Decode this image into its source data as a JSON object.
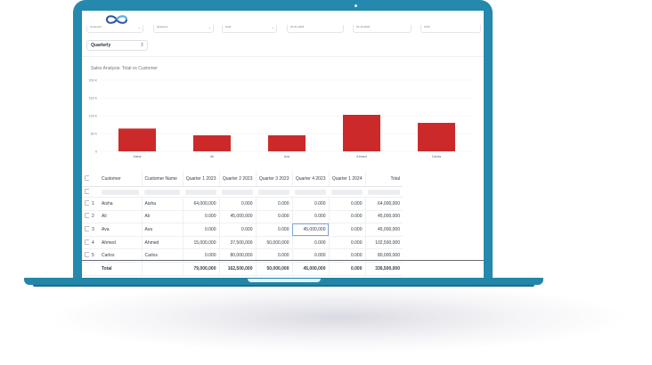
{
  "filters": {
    "items": [
      {
        "label": "Customer"
      },
      {
        "label": "Quarterly"
      },
      {
        "label": "Total"
      },
      {
        "label": "01-01-2023"
      },
      {
        "label": "31-12-2024"
      },
      {
        "label": "0.0%"
      }
    ],
    "period": {
      "label": "Quarterly"
    }
  },
  "chart": {
    "title": "Sales Analysis: Total vs Customer"
  },
  "chart_data": {
    "type": "bar",
    "title": "Sales Analysis: Total vs Customer",
    "categories": [
      "Aisha",
      "Ali",
      "Ava",
      "Ahmed",
      "Carlos"
    ],
    "values": [
      64000000,
      45000000,
      45000000,
      102500000,
      80000000
    ],
    "yticks": [
      "0",
      "50 K",
      "100 K",
      "150 K",
      "200 K"
    ],
    "ylim": [
      0,
      200000000
    ],
    "color": "#cc2a2a",
    "grid": true
  },
  "table": {
    "columns": [
      "Customer",
      "Customer Name",
      "Quarter 1 2023",
      "Quarter 2 2023",
      "Quarter 3 2023",
      "Quarter 4 2023",
      "Quarter 1 2024",
      "Total"
    ],
    "rows": [
      {
        "idx": "1",
        "customer": "Aisha",
        "name": "Aisha",
        "q1": "64,000,000",
        "q2": "0.000",
        "q3": "0.000",
        "q4": "0.000",
        "q5": "0.000",
        "total": "64,000,000"
      },
      {
        "idx": "2",
        "customer": "Ali",
        "name": "Ali",
        "q1": "0.000",
        "q2": "45,000,000",
        "q3": "0.000",
        "q4": "0.000",
        "q5": "0.000",
        "total": "45,000,000"
      },
      {
        "idx": "3",
        "customer": "Ava",
        "name": "Ava",
        "q1": "0.000",
        "q2": "0.000",
        "q3": "0.000",
        "q4": "45,000,000",
        "q5": "0.000",
        "total": "45,000,000"
      },
      {
        "idx": "4",
        "customer": "Ahmed",
        "name": "Ahmed",
        "q1": "15,000,000",
        "q2": "37,500,000",
        "q3": "50,000,000",
        "q4": "0.000",
        "q5": "0.000",
        "total": "102,500,000"
      },
      {
        "idx": "5",
        "customer": "Carlos",
        "name": "Carlos",
        "q1": "0.000",
        "q2": "80,000,000",
        "q3": "0.000",
        "q4": "0.000",
        "q5": "0.000",
        "total": "80,000,000"
      }
    ],
    "totals": {
      "label": "Total",
      "q1": "79,000,000",
      "q2": "162,500,000",
      "q3": "50,000,000",
      "q4": "45,000,000",
      "q5": "0.000",
      "total": "336,500,000"
    }
  }
}
